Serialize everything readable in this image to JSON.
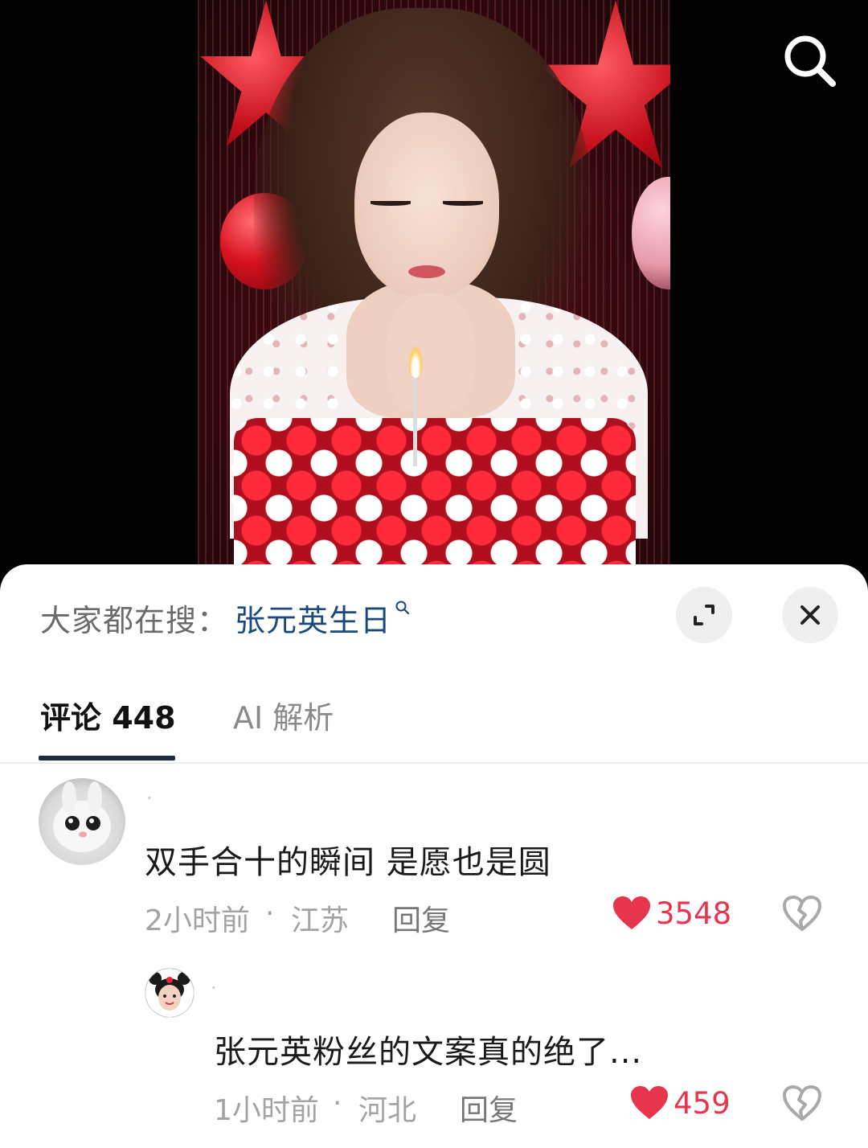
{
  "video": {
    "search_icon": "search-icon"
  },
  "sheet": {
    "trending_prefix": "大家都在搜：",
    "trending_term": "张元英生日",
    "expand_icon": "expand-icon",
    "close_icon": "close-icon"
  },
  "tabs": [
    {
      "label": "评论 448",
      "active": true
    },
    {
      "label": "AI 解析",
      "active": false
    }
  ],
  "comments": [
    {
      "username": ".",
      "text": "双手合十的瞬间 是愿也是圆",
      "time": "2小时前",
      "location": "江苏",
      "reply_label": "回复",
      "likes": "3548"
    },
    {
      "username": ".",
      "text": "张元英粉丝的文案真的绝了...",
      "time": "1小时前",
      "location": "河北",
      "reply_label": "回复",
      "likes": "459"
    }
  ],
  "colors": {
    "accent_like": "#e8354e",
    "trending_term": "#1b4a7a",
    "tab_underline": "#1f2b3a"
  }
}
